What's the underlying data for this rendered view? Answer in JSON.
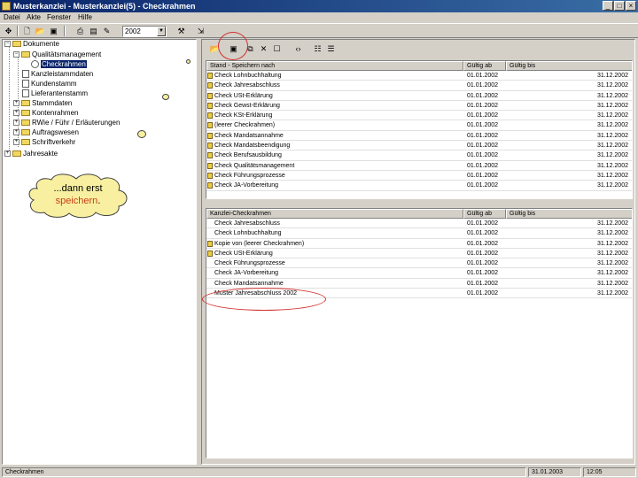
{
  "window": {
    "title": "Musterkanzlei - Musterkanzlei(5) - Checkrahmen",
    "min": "_",
    "max": "□",
    "close": "×"
  },
  "menu": [
    "Datei",
    "Akte",
    "Fenster",
    "Hilfe"
  ],
  "toolbar": {
    "year": "2002"
  },
  "tree": {
    "root": "Dokumente",
    "items": [
      {
        "label": "Qualitätsmanagement"
      },
      {
        "label": "Checkrahmen"
      },
      {
        "label": "Kanzleistammdaten"
      },
      {
        "label": "Kundenstamm"
      },
      {
        "label": "Lieferantenstamm"
      },
      {
        "label": "Stammdaten"
      },
      {
        "label": "Kontenrahmen"
      },
      {
        "label": "RWie / Führ / Erläuterungen"
      },
      {
        "label": "Auftragswesen"
      },
      {
        "label": "Schriftverkehr"
      },
      {
        "label": "Jahresakte"
      }
    ]
  },
  "callout": {
    "line1": "...dann erst",
    "line2_red": "speichern",
    "line2_rest": "."
  },
  "top_grid": {
    "headers": [
      "Stand - Speichern nach",
      "Gültig ab",
      "Gültig bis"
    ],
    "rows": [
      {
        "name": "Check Lohnbuchhaltung",
        "from": "01.01.2002",
        "to": "31.12.2002",
        "flag": true
      },
      {
        "name": "Check Jahresabschluss",
        "from": "01.01.2002",
        "to": "31.12.2002",
        "flag": true
      },
      {
        "name": "Check USt-Erklärung",
        "from": "01.01.2002",
        "to": "31.12.2002",
        "flag": true
      },
      {
        "name": "Check Gewst-Erklärung",
        "from": "01.01.2002",
        "to": "31.12.2002",
        "flag": true
      },
      {
        "name": "Check KSt-Erklärung",
        "from": "01.01.2002",
        "to": "31.12.2002",
        "flag": true
      },
      {
        "name": "(leerer Checkrahmen)",
        "from": "01.01.2002",
        "to": "31.12.2002",
        "flag": true
      },
      {
        "name": "Check Mandatsannahme",
        "from": "01.01.2002",
        "to": "31.12.2002",
        "flag": true
      },
      {
        "name": "Check Mandatsbeendigung",
        "from": "01.01.2002",
        "to": "31.12.2002",
        "flag": true
      },
      {
        "name": "Check Berufsausbildung",
        "from": "01.01.2002",
        "to": "31.12.2002",
        "flag": true
      },
      {
        "name": "Check Qualitätsmanagement",
        "from": "01.01.2002",
        "to": "31.12.2002",
        "flag": true
      },
      {
        "name": "Check Führungsprozesse",
        "from": "01.01.2002",
        "to": "31.12.2002",
        "flag": true
      },
      {
        "name": "Check JA-Vorbereitung",
        "from": "01.01.2002",
        "to": "31.12.2002",
        "flag": true
      }
    ]
  },
  "bottom_grid": {
    "headers": [
      "Kanzlei-Checkrahmen",
      "Gültig ab",
      "Gültig bis"
    ],
    "rows": [
      {
        "name": "Check Jahresabschluss",
        "from": "01.01.2002",
        "to": "31.12.2002",
        "flag": false
      },
      {
        "name": "Check Lohnbuchhaltung",
        "from": "01.01.2002",
        "to": "31.12.2002",
        "flag": false
      },
      {
        "name": "Kopie von (leerer Checkrahmen)",
        "from": "01.01.2002",
        "to": "31.12.2002",
        "flag": true
      },
      {
        "name": "Check USt-Erklärung",
        "from": "01.01.2002",
        "to": "31.12.2002",
        "flag": true
      },
      {
        "name": "Check Führungsprozesse",
        "from": "01.01.2002",
        "to": "31.12.2002",
        "flag": false
      },
      {
        "name": "Check JA-Vorbereitung",
        "from": "01.01.2002",
        "to": "31.12.2002",
        "flag": false
      },
      {
        "name": "Check Mandatsannahme",
        "from": "01.01.2002",
        "to": "31.12.2002",
        "flag": false
      },
      {
        "name": "Muster Jahresabschluss 2002",
        "from": "01.01.2002",
        "to": "31.12.2002",
        "flag": false
      }
    ]
  },
  "status": {
    "text": "Checkrahmen",
    "date": "31.01.2003",
    "time": "12:05"
  }
}
